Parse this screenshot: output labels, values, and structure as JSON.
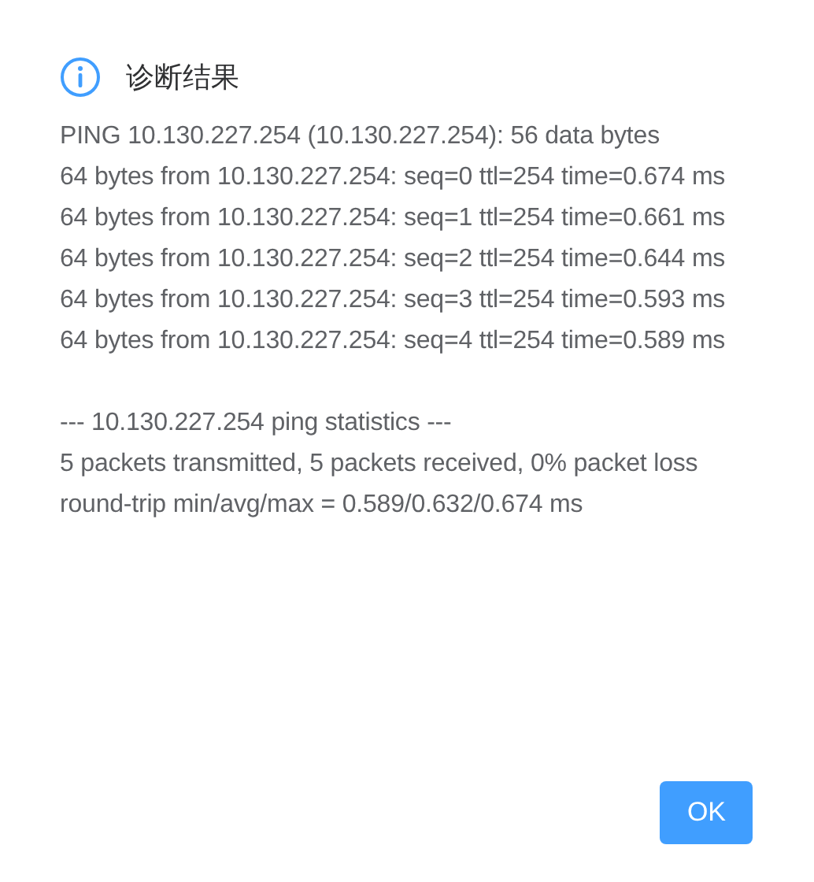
{
  "dialog": {
    "title": "诊断结果",
    "output": {
      "reply_lines": [
        "PING 10.130.227.254 (10.130.227.254): 56 data bytes",
        "64 bytes from 10.130.227.254: seq=0 ttl=254 time=0.674 ms",
        "64 bytes from 10.130.227.254: seq=1 ttl=254 time=0.661 ms",
        "64 bytes from 10.130.227.254: seq=2 ttl=254 time=0.644 ms",
        "64 bytes from 10.130.227.254: seq=3 ttl=254 time=0.593 ms",
        "64 bytes from 10.130.227.254: seq=4 ttl=254 time=0.589 ms"
      ],
      "statistics_lines": [
        "--- 10.130.227.254 ping statistics ---",
        "5 packets transmitted, 5 packets received, 0% packet loss",
        "round-trip min/avg/max = 0.589/0.632/0.674 ms"
      ]
    },
    "buttons": [
      "OK"
    ]
  }
}
